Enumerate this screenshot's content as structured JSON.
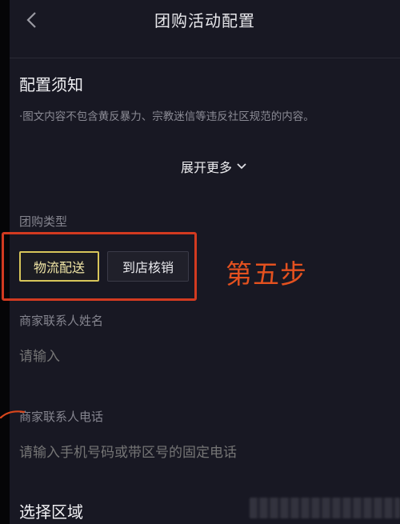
{
  "header": {
    "title": "团购活动配置",
    "back_icon": "chevron-left-icon"
  },
  "notice": {
    "title": "配置须知",
    "text": "·图文内容不包含黄反暴力、宗教迷信等违反社区规范的内容。",
    "expand_label": "展开更多",
    "expand_icon": "chevron-down-icon"
  },
  "group_type": {
    "label": "团购类型",
    "options": [
      {
        "label": "物流配送",
        "selected": true
      },
      {
        "label": "到店核销",
        "selected": false
      }
    ]
  },
  "annotation": {
    "step": "第五步",
    "highlight_color": "#d23a20"
  },
  "contact_name": {
    "label": "商家联系人姓名",
    "placeholder": "请输入"
  },
  "contact_phone": {
    "label": "商家联系人电话",
    "placeholder": "请输入手机号码或带区号的固定电话"
  },
  "region": {
    "label": "选择区域"
  },
  "colors": {
    "background": "#181823",
    "selected_border": "#d8c65a",
    "annotation_text": "#e4511f"
  }
}
